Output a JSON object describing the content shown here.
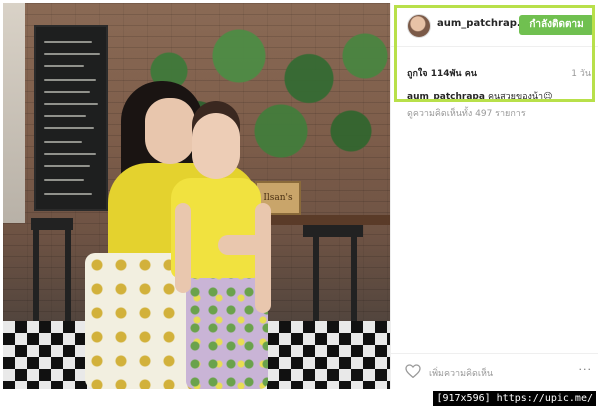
{
  "post": {
    "username": "aum_patchrap..",
    "follow_label": "กำลังติดตาม",
    "likes": "ถูกใจ 114พัน คน",
    "time": "1 วัน",
    "caption_user": "aum_patchrapa",
    "caption_text": "คนสวยของน้า😉",
    "comments_link": "ดูความคิดเห็นทั้ง 497 รายการ",
    "add_comment_placeholder": "เพิ่มความคิดเห็น",
    "more_label": "···"
  },
  "photo": {
    "sign_text": "Ilsan's"
  },
  "watermark": "[917x596] https://upic.me/",
  "icons": {
    "heart": "heart-icon",
    "more": "more-options-icon",
    "avatar": "avatar"
  },
  "colors": {
    "follow_button": "#70c050",
    "highlight_border": "#b8e04a"
  }
}
